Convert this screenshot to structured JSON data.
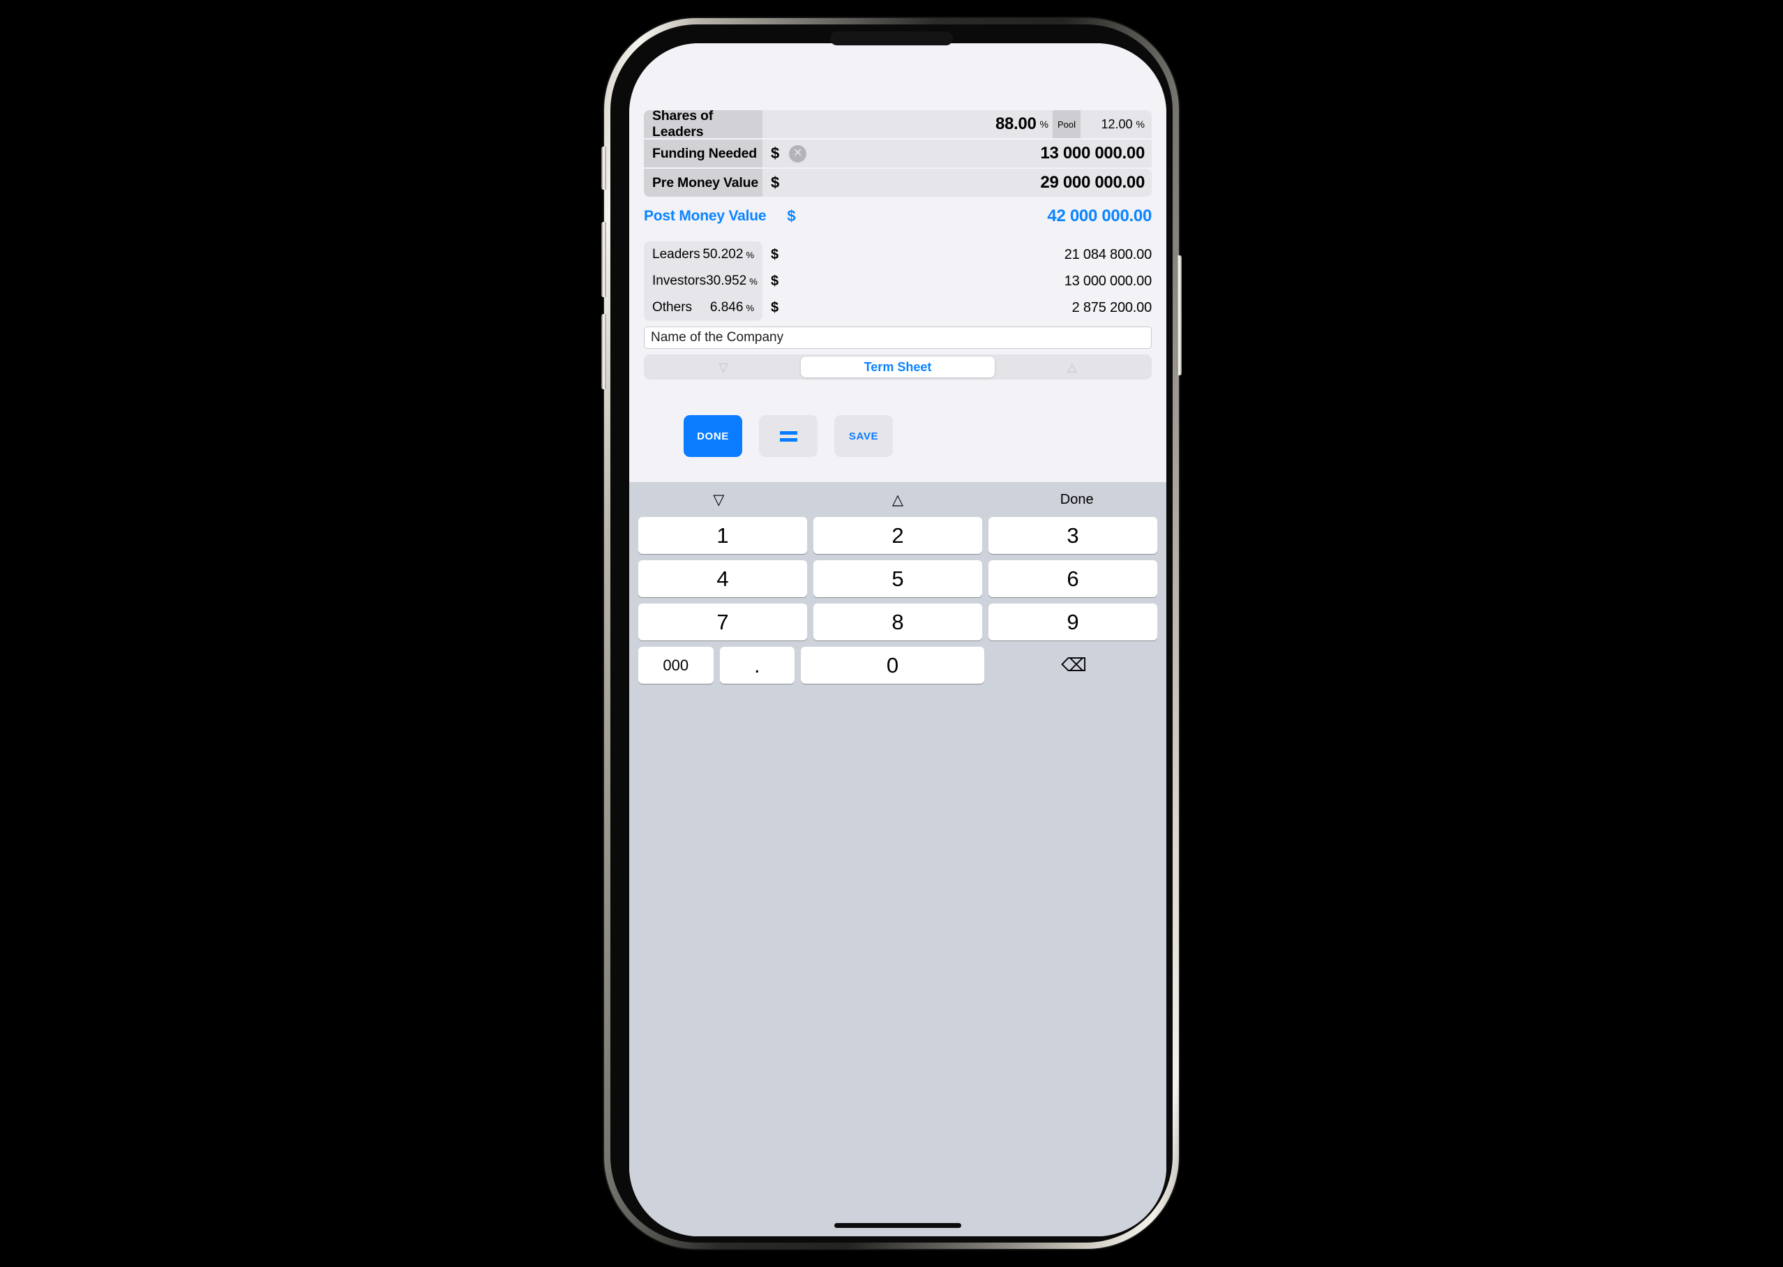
{
  "top_grid": {
    "rows": [
      {
        "label": "Shares of Leaders",
        "value": "88.00",
        "unit": "%",
        "pool_label": "Pool",
        "pool_value": "12.00",
        "pool_unit": "%"
      },
      {
        "label": "Funding Needed",
        "currency": "$",
        "clear_icon": "clear-circle-icon",
        "value": "13 000 000.00"
      },
      {
        "label": "Pre Money Value",
        "currency": "$",
        "value": "29 000 000.00"
      }
    ]
  },
  "post_money": {
    "label": "Post Money Value",
    "currency": "$",
    "value": "42 000 000.00",
    "accent_color": "#0a84ff"
  },
  "breakdown": {
    "rows": [
      {
        "name": "Leaders",
        "percent": "50.202",
        "percent_symbol": "%",
        "currency": "$",
        "amount": "21 084 800.00"
      },
      {
        "name": "Investors",
        "percent": "30.952",
        "percent_symbol": "%",
        "currency": "$",
        "amount": "13 000 000.00"
      },
      {
        "name": "Others",
        "percent": "6.846",
        "percent_symbol": "%",
        "currency": "$",
        "amount": "2 875 200.00"
      }
    ]
  },
  "company_field": {
    "value": "Name of the Company",
    "placeholder": "Name of the Company"
  },
  "segmented": {
    "prev_icon": "triangle-down-icon",
    "prev_glyph": "▽",
    "center_label": "Term Sheet",
    "next_icon": "triangle-up-icon",
    "next_glyph": "△"
  },
  "actions": {
    "done_label": "DONE",
    "equals_icon": "equals-icon",
    "save_label": "SAVE",
    "primary_color": "#0a7cff"
  },
  "keyboard": {
    "toolbar": {
      "prev_glyph": "▽",
      "next_glyph": "△",
      "done_label": "Done"
    },
    "rows": [
      [
        "1",
        "2",
        "3"
      ],
      [
        "4",
        "5",
        "6"
      ],
      [
        "7",
        "8",
        "9"
      ]
    ],
    "bottom": {
      "triple_zero": "000",
      "decimal": ".",
      "zero": "0",
      "backspace_glyph": "⌫",
      "backspace_icon": "backspace-icon"
    }
  }
}
